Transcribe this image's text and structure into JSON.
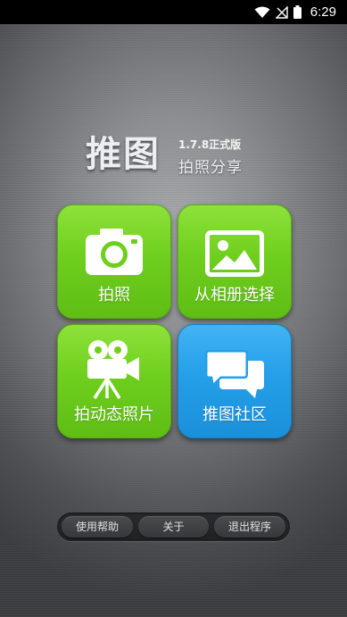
{
  "status_bar": {
    "time": "6:29",
    "icons": [
      "wifi-icon",
      "signal-off-icon",
      "battery-icon"
    ]
  },
  "logo": {
    "main": "推图",
    "version": "1.7.8正式版",
    "subtitle": "拍照分享"
  },
  "tiles": [
    {
      "label": "拍照",
      "icon": "camera-icon",
      "color": "#6fcf1e"
    },
    {
      "label": "从相册选择",
      "icon": "picture-icon",
      "color": "#6fcf1e"
    },
    {
      "label": "拍动态照片",
      "icon": "video-camera-icon",
      "color": "#6fcf1e"
    },
    {
      "label": "推图社区",
      "icon": "chat-bubbles-icon",
      "color": "#249fe8"
    }
  ],
  "menu": {
    "help": "使用帮助",
    "about": "关于",
    "exit": "退出程序"
  }
}
